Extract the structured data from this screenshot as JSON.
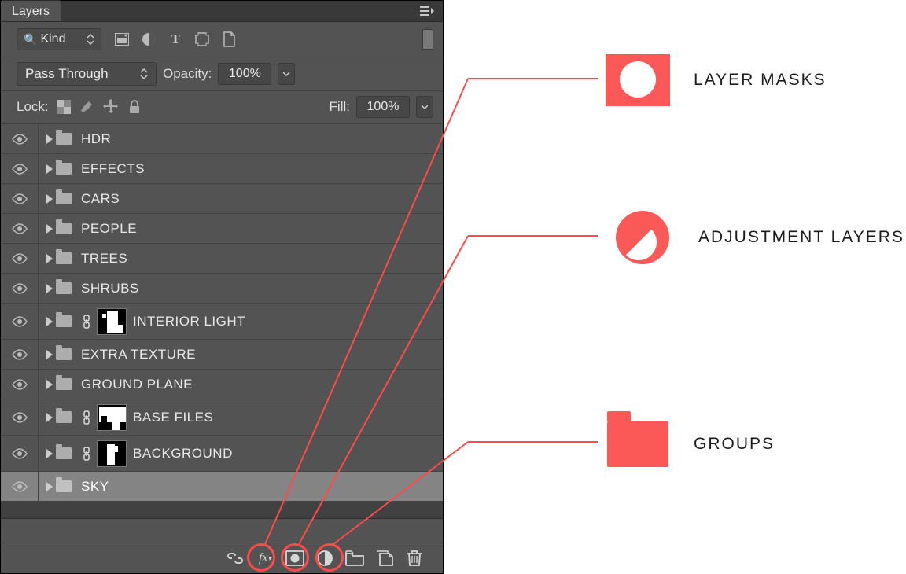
{
  "panel": {
    "title": "Layers"
  },
  "filter": {
    "kind_label": "Kind"
  },
  "blend": {
    "mode": "Pass Through",
    "opacity_label": "Opacity:",
    "opacity_value": "100%",
    "fill_label": "Fill:",
    "fill_value": "100%",
    "lock_label": "Lock:"
  },
  "layers": [
    {
      "name": "HDR",
      "tall": false,
      "linked": false,
      "mask": null,
      "selected": false
    },
    {
      "name": "EFFECTS",
      "tall": false,
      "linked": false,
      "mask": null,
      "selected": false
    },
    {
      "name": "CARS",
      "tall": false,
      "linked": false,
      "mask": null,
      "selected": false
    },
    {
      "name": "PEOPLE",
      "tall": false,
      "linked": false,
      "mask": null,
      "selected": false
    },
    {
      "name": "TREES",
      "tall": false,
      "linked": false,
      "mask": null,
      "selected": false
    },
    {
      "name": "SHRUBS",
      "tall": false,
      "linked": false,
      "mask": null,
      "selected": false
    },
    {
      "name": "INTERIOR LIGHT",
      "tall": true,
      "linked": true,
      "mask": "interior",
      "selected": false
    },
    {
      "name": "EXTRA TEXTURE",
      "tall": false,
      "linked": false,
      "mask": null,
      "selected": false
    },
    {
      "name": "GROUND PLANE",
      "tall": false,
      "linked": false,
      "mask": null,
      "selected": false
    },
    {
      "name": "BASE FILES",
      "tall": true,
      "linked": true,
      "mask": "base",
      "selected": false
    },
    {
      "name": "BACKGROUND",
      "tall": true,
      "linked": true,
      "mask": "bg",
      "selected": false
    },
    {
      "name": "SKY",
      "tall": false,
      "linked": false,
      "mask": null,
      "selected": true
    }
  ],
  "callouts": {
    "mask_label": "LAYER MASKS",
    "adj_label": "ADJUSTMENT LAYERS",
    "group_label": "GROUPS"
  }
}
